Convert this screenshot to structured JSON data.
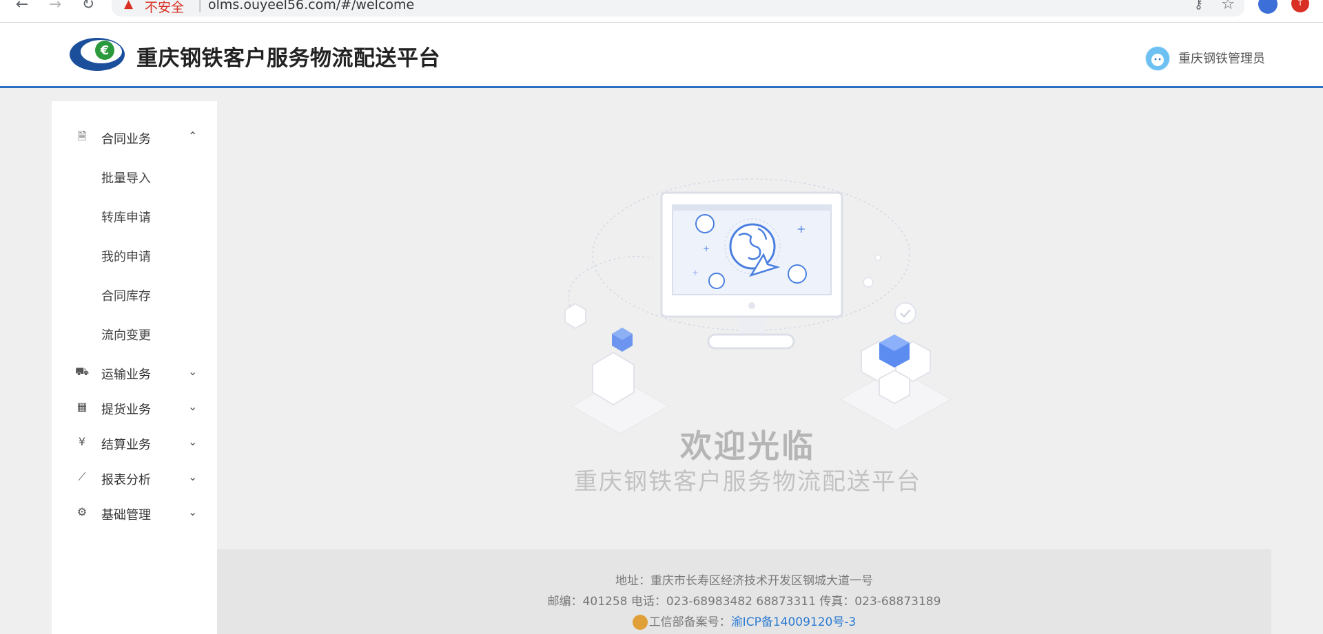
{
  "browser": {
    "back_icon": "←",
    "forward_icon": "→",
    "reload_icon": "↻",
    "warning_icon": "▲",
    "insecure_label": "不安全",
    "separator": "|",
    "url": "olms.ouyeel56.com/#/welcome",
    "key_icon": "⚷",
    "star_icon": "☆",
    "ext2_icon": "↑"
  },
  "header": {
    "title": "重庆钢铁客户服务物流配送平台",
    "user_name": "重庆钢铁管理员",
    "accent_color": "#2a6fc2"
  },
  "sidebar": {
    "menus": [
      {
        "label": "合同业务",
        "icon": "document-icon",
        "glyph": "🗎",
        "arrow": "⌃"
      },
      {
        "label": "运输业务",
        "icon": "car-icon",
        "glyph": "⛟",
        "arrow": "⌄"
      },
      {
        "label": "提货业务",
        "icon": "grid-icon",
        "glyph": "▦",
        "arrow": "⌄"
      },
      {
        "label": "结算业务",
        "icon": "yen-icon",
        "glyph": "¥",
        "arrow": "⌄"
      },
      {
        "label": "报表分析",
        "icon": "line-chart-icon",
        "glyph": "⟋",
        "arrow": "⌄"
      },
      {
        "label": "基础管理",
        "icon": "gear-icon",
        "glyph": "⚙",
        "arrow": "⌄"
      }
    ],
    "contract_sub": [
      "批量导入",
      "转库申请",
      "我的申请",
      "合同库存",
      "流向变更"
    ]
  },
  "main": {
    "welcome_title": "欢迎光临",
    "welcome_subtitle": "重庆钢铁客户服务物流配送平台"
  },
  "footer": {
    "address": "地址：重庆市长寿区经济技术开发区钢城大道一号",
    "contact": "邮编：401258 电话：023-68983482 68873311 传真：023-68873189",
    "icp_prefix": "工信部备案号：",
    "icp_link": "渝ICP备14009120号-3"
  }
}
